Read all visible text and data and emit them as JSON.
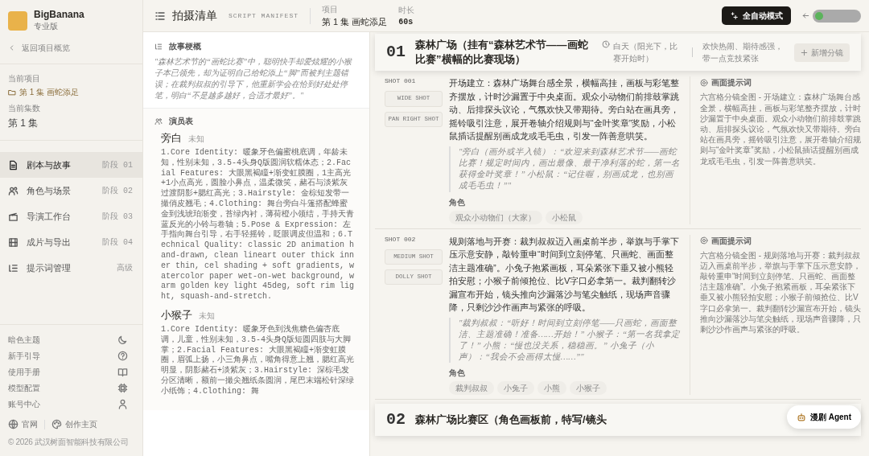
{
  "sidebar": {
    "brand": {
      "name": "BigBanana",
      "edition": "专业版"
    },
    "back_link": "返回项目概览",
    "project_label": "当前项目",
    "project_name": "第 1 集 画蛇添足",
    "episode_label": "当前集数",
    "episode": "第 1 集",
    "nav": [
      {
        "label": "剧本与故事",
        "tag": "阶段 01",
        "selected": true
      },
      {
        "label": "角色与场景",
        "tag": "阶段 02",
        "selected": false
      },
      {
        "label": "导演工作台",
        "tag": "阶段 03",
        "selected": false
      },
      {
        "label": "成片与导出",
        "tag": "阶段 04",
        "selected": false
      },
      {
        "label": "提示词管理",
        "tag": "高级",
        "selected": false
      }
    ],
    "settings": [
      "暗色主题",
      "新手引导",
      "使用手册",
      "模型配置",
      "账号中心"
    ],
    "links": [
      "官网",
      "创作主页"
    ],
    "copyright": "© 2026 武汉树面智能科技有限公司"
  },
  "header": {
    "title": "拍摄清单",
    "subtitle": "SCRIPT MANIFEST",
    "project_label": "项目",
    "project": "第 1 集 画蛇添足",
    "duration_label": "时长",
    "duration": "60s",
    "auto_button": "全自动模式"
  },
  "synopsis": {
    "heading": "故事梗概",
    "text": "\"森林艺术节的“画蛇比赛”中，聪明快手却爱炫耀的小猴子本已领先，却为证明自己给蛇添上“脚”而被判主题错误；在裁判叔叔的引导下，他重新学会在恰到好处处停笔，明白“不是越多越好，合适才最好”。\""
  },
  "cast": {
    "heading": "演员表",
    "characters": [
      {
        "name": "旁白",
        "role": "未知",
        "description": "1.Core Identity: 暖象牙色偏蜜桃底调，年龄未知，性别未知，3.5-4头身Q版圆润软糯体态；2.Facial Features: 大眼黑褐瞳+渐变虹膜圈，1主高光+1小点高光，圆脸小鼻点，温柔微笑，赭石与淡紫灰过渡阴影+腮红高光；3.Hairstyle: 金棕短发带一撮俏皮翘毛；4.Clothing: 舞台旁白斗篷搭配蜂蜜金到浅琥珀渐变，苔绿内衬，薄荷橙小领结，手持天青蓝反光的小铃与卷轴；5.Pose & Expression: 左手指向舞台引导，右手轻摇铃，眨眼调皮但温和；6.Technical Quality: classic 2D animation hand-drawn, clean lineart outer thick inner thin, cel shading + soft gradients, watercolor paper wet-on-wet background, warm golden key light 45deg, soft rim light, squash-and-stretch."
      },
      {
        "name": "小猴子",
        "role": "未知",
        "description": "1.Core Identity: 暖象牙色到浅焦糖色偏杏底调，儿童，性别未知，3.5-4头身Q版短圆四肢与大脚掌；2.Facial Features: 大眼黑褐瞳+渐变虹膜圈，眉弧上扬，小三角鼻点，嘴角得意上翘，腮红高光明显，阴影赭石+淡紫灰；3.Hairstyle: 深棕毛发分区清晰，额前一撮尖翘纸条圆润，尾巴末端松针深绿小纸饰；4.Clothing: 舞"
      }
    ]
  },
  "scenes": [
    {
      "number": "01",
      "title": "森林广场（挂有“森林艺术节——画蛇比赛”横幅的比赛现场）",
      "time": "白天（阳光下，比赛开始时）",
      "mood": "欢快热闹、期待感强，带一点竞技紧张",
      "add_button": "新增分镜",
      "shots": [
        {
          "label": "SHOT 001",
          "tags": [
            "WIDE SHOT",
            "PAN RIGHT SHOT"
          ],
          "action": "开场建立：森林广场舞台感全景，横幅高挂，画板与彩笔整齐摆放，计时沙漏置于中央桌面。观众小动物们前排鼓掌跳动、后排探头议论，气氛欢快又带期待。旁白站在画具旁，摇铃吸引注意，展开卷轴介绍规则与“金叶奖章”奖励，小松鼠插话提醒别画成龙或毛毛虫，引发一阵善意哄笑。",
          "dialogue": "\"旁白（画外或半入镜）：“欢迎来到森林艺术节——画蛇比赛！规定时间内，画出最像、最干净利落的蛇，第一名获得金叶奖章！” 小松鼠：“记住喔，别画成龙，也别画成毛毛虫！”\"",
          "roles_label": "角色",
          "roles": [
            "观众小动物们（大家）",
            "小松鼠"
          ],
          "prompt_label": "画面提示词",
          "prompt": "六宫格分镜全图 - 开场建立：森林广场舞台感全景，横幅高挂，画板与彩笔整齐摆放，计时沙漏置于中央桌面。观众小动物们前排鼓掌跳动、后排探头议论，气氛欢快又带期待。旁白站在画具旁，摇铃吸引注意，展开卷轴介绍规则与“金叶奖章”奖励，小松鼠插话提醒别画成龙或毛毛虫，引发一阵善意哄笑。"
        },
        {
          "label": "SHOT 002",
          "tags": [
            "MEDIUM SHOT",
            "DOLLY SHOT"
          ],
          "action": "规则落地与开赛：裁判叔叔迈入画桌前半步，举旗与手掌下压示意安静，敲铃重申“时间到立刻停笔、只画蛇、画面整洁主题准确”。小兔子抱紧画板，耳朵紧张下垂又被小熊轻拍安慰；小猴子前倾抢位、比V字口必拿第一。裁判翻转沙漏宣布开始，镜头推向沙漏落沙与笔尖触纸，现场声音骤降，只剩沙沙作画声与紧张的呼吸。",
          "dialogue": "\"裁判叔叔：“听好！时间到立刻停笔——只画蛇，画面整洁、主题准确！准备……开始！” 小猴子：“第一名我拿定了！” 小熊：“慢也没关系，稳稳画。” 小兔子（小声）：“我会不会画得太慢……”\"",
          "roles_label": "角色",
          "roles": [
            "裁判叔叔",
            "小兔子",
            "小熊",
            "小猴子"
          ],
          "prompt_label": "画面提示词",
          "prompt": "六宫格分镜全图 - 规则落地与开赛：裁判叔叔迈入画桌前半步，举旗与手掌下压示意安静，敲铃重申“时间到立刻停笔、只画蛇、画面整洁主题准确”。小兔子抱紧画板，耳朵紧张下垂又被小熊轻拍安慰；小猴子前倾抢位、比V字口必拿第一。裁判翻转沙漏宣布开始，镜头推向沙漏落沙与笔尖触纸，现场声音骤降，只剩沙沙作画声与紧张的呼吸。"
        }
      ]
    },
    {
      "number": "02",
      "title": "森林广场比赛区（角色画板前，特写/镜头"
    }
  ],
  "agent_button": "漫剧 Agent"
}
